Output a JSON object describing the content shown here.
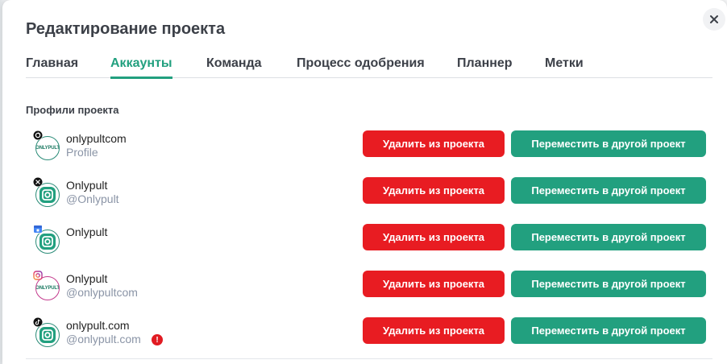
{
  "modal": {
    "title": "Редактирование проекта",
    "close_icon": "close-icon"
  },
  "tabs": [
    {
      "label": "Главная",
      "active": false
    },
    {
      "label": "Аккаунты",
      "active": true
    },
    {
      "label": "Команда",
      "active": false
    },
    {
      "label": "Процесс одобрения",
      "active": false
    },
    {
      "label": "Планнер",
      "active": false
    },
    {
      "label": "Метки",
      "active": false
    }
  ],
  "section": {
    "title": "Профили проекта"
  },
  "logo_text": "ONLYPULT",
  "accounts": [
    {
      "network": "threads",
      "network_icon": "threads-icon",
      "name": "onlypultcom",
      "handle": "Profile",
      "warning": false
    },
    {
      "network": "x",
      "network_icon": "x-icon",
      "name": "Onlypult",
      "handle": "@Onlypult",
      "warning": false
    },
    {
      "network": "google-business",
      "network_icon": "google-business-icon",
      "name": "Onlypult",
      "handle": "",
      "warning": false
    },
    {
      "network": "instagram",
      "network_icon": "instagram-icon",
      "name": "Onlypult",
      "handle": "@onlypultcom",
      "warning": false
    },
    {
      "network": "tiktok",
      "network_icon": "tiktok-icon",
      "name": "onlypult.com",
      "handle": "@onlypult.com",
      "warning": true
    }
  ],
  "actions": {
    "remove_label": "Удалить из проекта",
    "move_label": "Переместить в другой проект"
  },
  "colors": {
    "accent": "#22a07f",
    "danger": "#e81c22",
    "text": "#3c4048",
    "muted": "#8a94a6"
  }
}
